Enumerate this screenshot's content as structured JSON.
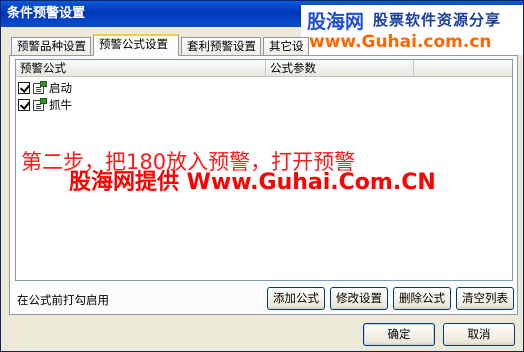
{
  "window": {
    "title": "条件预警设置"
  },
  "watermark": {
    "logo_text": "股海网",
    "slogan": "股票软件资源分享",
    "url": "www.Guhai.com.cn"
  },
  "tabs": [
    {
      "label": "预警品种设置"
    },
    {
      "label": "预警公式设置"
    },
    {
      "label": "套利预警设置"
    },
    {
      "label": "其它设"
    }
  ],
  "list": {
    "columns": [
      "预警公式",
      "公式参数"
    ],
    "rows": [
      {
        "checked": true,
        "name": "启动",
        "params": ""
      },
      {
        "checked": true,
        "name": "抓牛",
        "params": ""
      }
    ]
  },
  "overlay": {
    "step_text": "第二步，把180放入预警，打开预警",
    "brand_text": "股海网提供 Www.Guhai.Com.CN"
  },
  "footer": {
    "hint": "在公式前打勾启用",
    "add_formula": "添加公式",
    "edit_settings": "修改设置",
    "delete_formula": "删除公式",
    "clear_list": "清空列表",
    "ok": "确定",
    "cancel": "取消"
  },
  "colors": {
    "title_bar": "#0a5ad9",
    "overlay_red": "#ff0000",
    "watermark_orange": "#ff6600",
    "watermark_blue": "#1f4fd2"
  }
}
